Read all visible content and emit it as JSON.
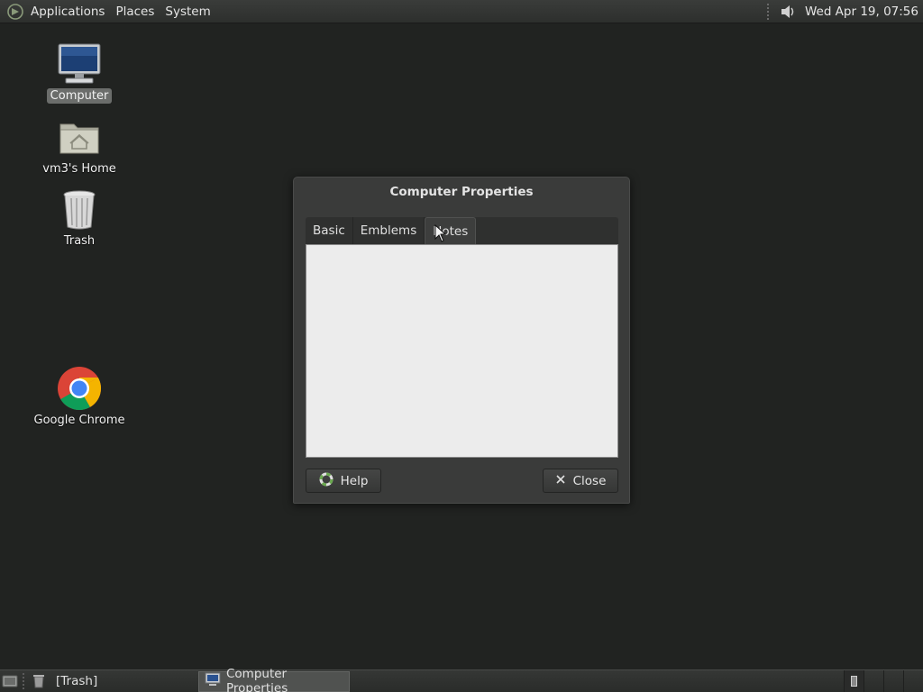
{
  "top_panel": {
    "menus": [
      "Applications",
      "Places",
      "System"
    ],
    "clock": "Wed Apr 19, 07:56"
  },
  "desktop": {
    "icons": [
      {
        "label": "Computer",
        "icon": "computer-icon",
        "selected": true
      },
      {
        "label": "vm3's Home",
        "icon": "home-folder-icon"
      },
      {
        "label": "Trash",
        "icon": "trash-icon"
      },
      {
        "label": "Google Chrome",
        "icon": "chrome-icon"
      }
    ]
  },
  "dialog": {
    "title": "Computer Properties",
    "tabs": [
      "Basic",
      "Emblems",
      "Notes"
    ],
    "active_tab": "Notes",
    "notes_text": "",
    "help_label": "Help",
    "close_label": "Close"
  },
  "taskbar": {
    "tasks": [
      {
        "label": "[Trash]",
        "active": false
      },
      {
        "label": "Computer Properties",
        "active": true
      }
    ]
  },
  "colors": {
    "desktop_bg": "#212321",
    "panel_bg": "#333533",
    "dialog_bg": "#3a3b3a"
  }
}
